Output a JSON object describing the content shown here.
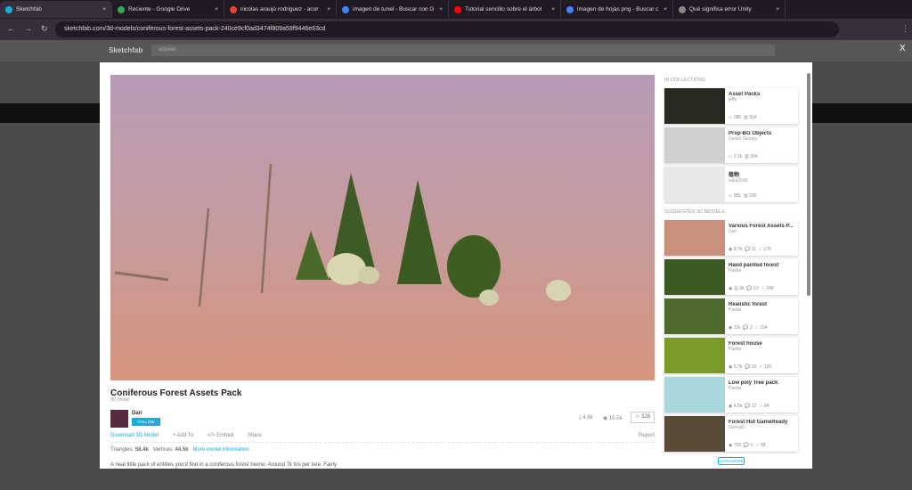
{
  "browser": {
    "tabs": [
      {
        "label": "Sketchfab",
        "color": "#1caad9"
      },
      {
        "label": "Reciente - Google Drive",
        "color": "#34a853"
      },
      {
        "label": "nicolas araujo rodriguez - acor",
        "color": "#ea4335"
      },
      {
        "label": "imagen de tunel - Buscar con G",
        "color": "#4285f4"
      },
      {
        "label": "Tutorial sencillo sobre el árbol",
        "color": "#ff0000"
      },
      {
        "label": "imagen de hojas png - Buscar c",
        "color": "#4285f4"
      },
      {
        "label": "Qué significa error Unity",
        "color": "#888888"
      }
    ],
    "url": "sketchfab.com/3d-models/coniferous-forest-assets-pack-240ce9cf0ad3474f809a59f9446e63cd"
  },
  "site": {
    "logo": "Sketchfab",
    "search": "arboles",
    "close": "X"
  },
  "model": {
    "title": "Coniferous Forest Assets Pack",
    "type": "3D Model",
    "author": "Dari",
    "follow": "FOLLOW",
    "downloads": "4.6k",
    "views": "15.5k",
    "likes": "328",
    "actions": {
      "download": "Download 3D Model",
      "add": "+ Add To",
      "embed": "</> Embed",
      "share": "Share",
      "report": "Report"
    },
    "triangles_label": "Triangles:",
    "triangles": "58.4k",
    "vertices_label": "Vertices:",
    "vertices": "44.5k",
    "more": "More model information",
    "description": "A neat little pack of entities you'd find in a coniferous forest biome. Around 7k tris per tree. Fairly"
  },
  "sidebar": {
    "collections_title": "IN COLLECTIONS",
    "collections": [
      {
        "name": "Asset Packs",
        "author": "jeffk",
        "s1": "280",
        "s2": "314",
        "bg": "#2a2a20"
      },
      {
        "name": "Prop-BG Objects",
        "author": "Daniel Zamary",
        "s1": "2.1k",
        "s2": "304",
        "bg": "#cfcfcf"
      },
      {
        "name": "植物",
        "author": "suka2049",
        "s1": "581",
        "s2": "295",
        "bg": "#e8e8e8"
      }
    ],
    "suggested_title": "SUGGESTED 3D MODELS",
    "suggested": [
      {
        "name": "Various Forest Assets P...",
        "author": "Dari",
        "views": "8.7k",
        "comments": "11",
        "likes": "176",
        "bg": "#c9917c"
      },
      {
        "name": "Hand painted forest",
        "author": "Pasha",
        "views": "11.9k",
        "comments": "13",
        "likes": "248",
        "bg": "#3d5a22"
      },
      {
        "name": "Realistic forest",
        "author": "Pasha",
        "views": "11k",
        "comments": "2",
        "likes": "154",
        "bg": "#4e6a2c"
      },
      {
        "name": "Forest house",
        "author": "Pasha",
        "views": "5.7k",
        "comments": "19",
        "likes": "120",
        "bg": "#7a9a2a"
      },
      {
        "name": "Low poly Tree pack",
        "author": "Pasha",
        "views": "6.5k",
        "comments": "12",
        "likes": "94",
        "bg": "#a8d8dc"
      },
      {
        "name": "Forest Hut GameReady",
        "author": "Gerhald",
        "views": "700",
        "comments": "0",
        "likes": "58",
        "bg": "#5a4a38"
      }
    ],
    "load_more": "LOAD MORE"
  }
}
